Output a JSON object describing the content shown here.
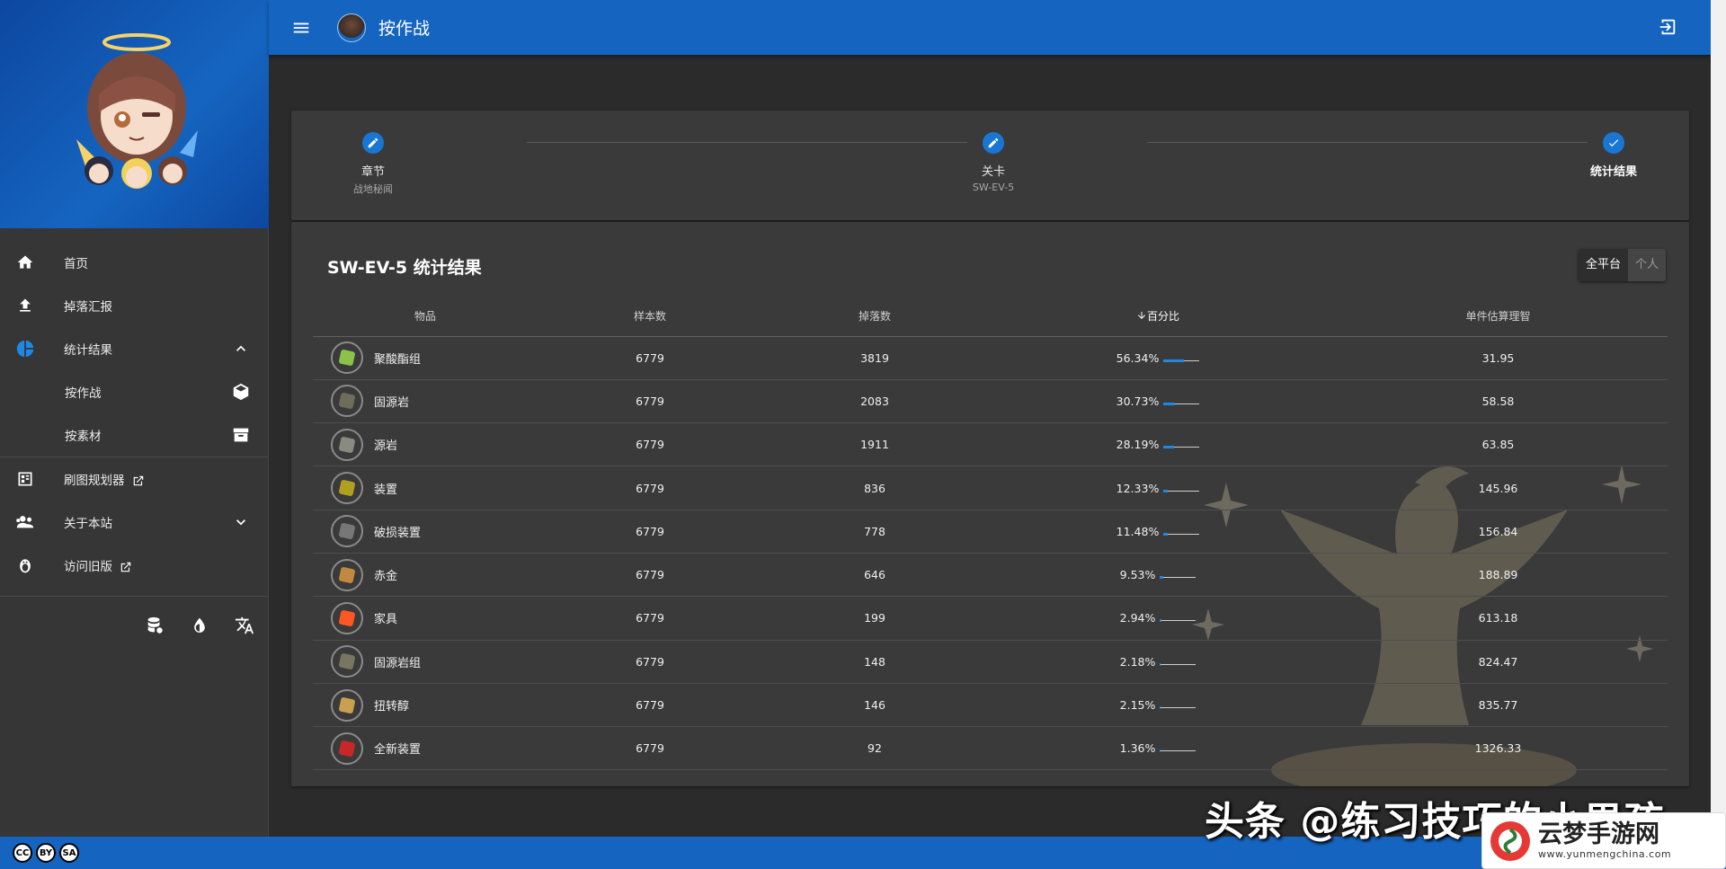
{
  "app_bar": {
    "title": "按作战"
  },
  "sidebar": {
    "items": [
      {
        "label": "首页",
        "icon": "home-icon"
      },
      {
        "label": "掉落汇报",
        "icon": "upload-icon"
      },
      {
        "label": "统计结果",
        "icon": "pie-chart-icon",
        "expanded": true
      },
      {
        "label": "按作战",
        "icon": "cube-icon",
        "sub": true
      },
      {
        "label": "按素材",
        "icon": "box-icon",
        "sub": true
      },
      {
        "label": "刷图规划器",
        "icon": "planner-icon",
        "external": true
      },
      {
        "label": "关于本站",
        "icon": "people-icon"
      },
      {
        "label": "访问旧版",
        "icon": "penguin-icon",
        "external": true
      }
    ],
    "tools": [
      "database-icon",
      "theme-drop-icon",
      "translate-icon"
    ]
  },
  "stepper": {
    "steps": [
      {
        "title": "章节",
        "subtitle": "战地秘闻"
      },
      {
        "title": "关卡",
        "subtitle": "SW-EV-5"
      },
      {
        "title": "统计结果",
        "subtitle": ""
      }
    ]
  },
  "results": {
    "title": "SW-EV-5 统计结果",
    "toggle": {
      "all": "全平台",
      "personal": "个人"
    },
    "columns": [
      "物品",
      "样本数",
      "掉落数",
      "百分比",
      "单件估算理智"
    ],
    "rows": [
      {
        "name": "聚酸酯组",
        "samples": "6779",
        "drops": "3819",
        "percent": "56.34%",
        "sanity": "31.95",
        "color": "#8bc34a"
      },
      {
        "name": "固源岩",
        "samples": "6779",
        "drops": "2083",
        "percent": "30.73%",
        "sanity": "58.58",
        "color": "#6d6d5a"
      },
      {
        "name": "源岩",
        "samples": "6779",
        "drops": "1911",
        "percent": "28.19%",
        "sanity": "63.85",
        "color": "#8a8a80"
      },
      {
        "name": "装置",
        "samples": "6779",
        "drops": "836",
        "percent": "12.33%",
        "sanity": "145.96",
        "color": "#b0a020"
      },
      {
        "name": "破损装置",
        "samples": "6779",
        "drops": "778",
        "percent": "11.48%",
        "sanity": "156.84",
        "color": "#777777"
      },
      {
        "name": "赤金",
        "samples": "6779",
        "drops": "646",
        "percent": "9.53%",
        "sanity": "188.89",
        "color": "#c08840"
      },
      {
        "name": "家具",
        "samples": "6779",
        "drops": "199",
        "percent": "2.94%",
        "sanity": "613.18",
        "color": "#ff5722"
      },
      {
        "name": "固源岩组",
        "samples": "6779",
        "drops": "148",
        "percent": "2.18%",
        "sanity": "824.47",
        "color": "#7a7560"
      },
      {
        "name": "扭转醇",
        "samples": "6779",
        "drops": "146",
        "percent": "2.15%",
        "sanity": "835.77",
        "color": "#c8a050"
      },
      {
        "name": "全新装置",
        "samples": "6779",
        "drops": "92",
        "percent": "1.36%",
        "sanity": "1326.33",
        "color": "#c62828"
      }
    ]
  },
  "footer": {
    "license_icons": [
      "CC",
      "BY",
      "SA"
    ]
  },
  "overlay": {
    "credit": "头条 @练习技巧的小男孩",
    "logo_name": "云梦手游网",
    "logo_url": "www.yunmengchina.com"
  },
  "colors": {
    "primary": "#1565c0",
    "accent": "#1976d2",
    "surface": "#3a3a3a"
  }
}
